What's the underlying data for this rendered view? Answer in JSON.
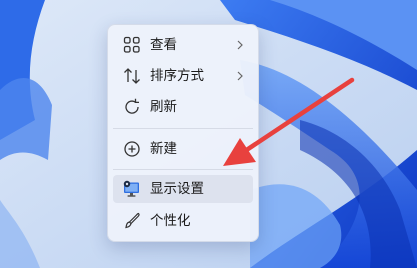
{
  "desktop": {
    "accent": "#1a4fd6",
    "background": "#cfe0f6"
  },
  "context_menu": {
    "items": [
      {
        "label": "查看",
        "icon": "grid-icon",
        "submenu": true
      },
      {
        "label": "排序方式",
        "icon": "sort-arrows-icon",
        "submenu": true
      },
      {
        "label": "刷新",
        "icon": "refresh-icon",
        "submenu": false
      },
      {
        "label": "新建",
        "icon": "add-circle-icon",
        "submenu": true
      },
      {
        "label": "显示设置",
        "icon": "display-settings-icon",
        "submenu": false,
        "highlighted": true
      },
      {
        "label": "个性化",
        "icon": "brush-icon",
        "submenu": false
      }
    ]
  },
  "annotation": {
    "color": "#e8413e",
    "points_to": "显示设置"
  }
}
